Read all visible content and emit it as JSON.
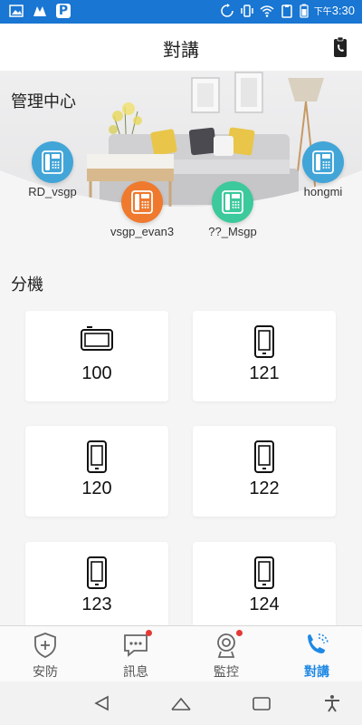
{
  "status_bar": {
    "time_prefix": "下午",
    "time": "3:30",
    "icons": [
      "image-icon",
      "app-icon",
      "parking-icon",
      "rotate-icon",
      "vibrate-icon",
      "wifi-icon",
      "clipboard-icon",
      "battery-icon"
    ]
  },
  "header": {
    "title": "對講",
    "action_icon": "clipboard-call-icon"
  },
  "management_center": {
    "title": "管理中心",
    "nodes": [
      {
        "label": "RD_vsgp",
        "color": "#42a5d8"
      },
      {
        "label": "vsgp_evan3",
        "color": "#ef7a2e"
      },
      {
        "label": "??_Msgp",
        "color": "#3cc99b"
      },
      {
        "label": "hongmi",
        "color": "#42a5d8"
      }
    ]
  },
  "extensions": {
    "title": "分機",
    "items": [
      {
        "label": "100",
        "icon": "tablet-landscape-icon"
      },
      {
        "label": "121",
        "icon": "phone-icon"
      },
      {
        "label": "120",
        "icon": "phone-icon"
      },
      {
        "label": "122",
        "icon": "phone-icon"
      },
      {
        "label": "123",
        "icon": "phone-icon"
      },
      {
        "label": "124",
        "icon": "phone-icon"
      }
    ]
  },
  "tabs": [
    {
      "label": "安防",
      "icon": "shield-plus-icon",
      "badge": false,
      "active": false
    },
    {
      "label": "訊息",
      "icon": "message-icon",
      "badge": true,
      "active": false
    },
    {
      "label": "監控",
      "icon": "camera-icon",
      "badge": true,
      "active": false
    },
    {
      "label": "對講",
      "icon": "intercom-call-icon",
      "badge": false,
      "active": true
    }
  ],
  "colors": {
    "status_bar": "#1976d2",
    "accent": "#1e88e5",
    "badge": "#e53935"
  }
}
